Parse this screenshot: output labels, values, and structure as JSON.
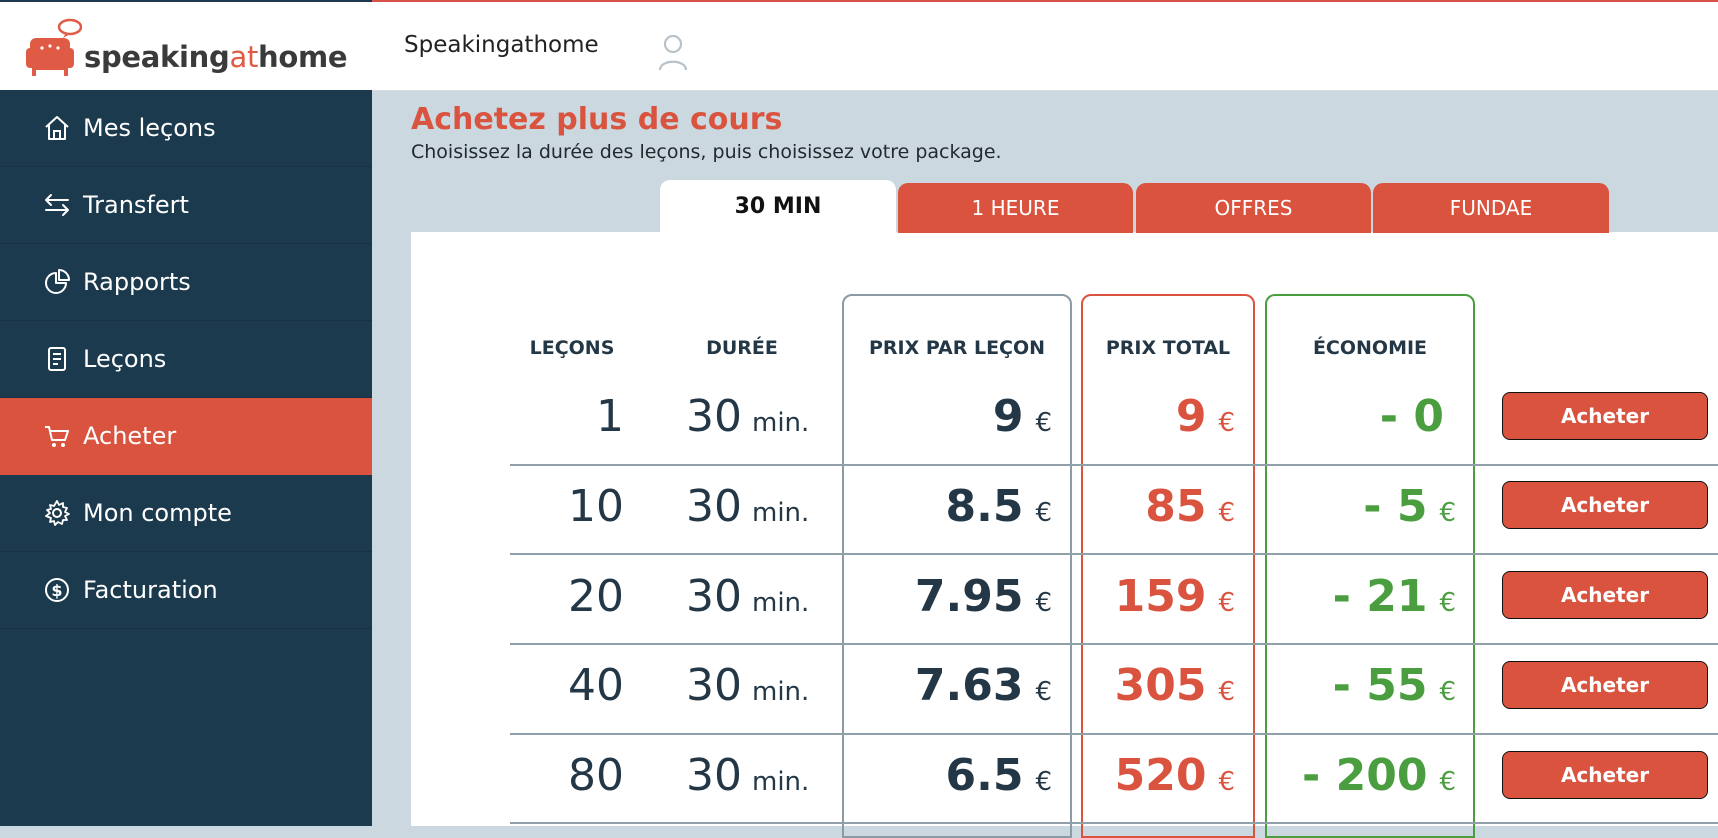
{
  "brand": {
    "logo_speaking": "speaking",
    "logo_at": "at",
    "logo_home": "home",
    "accent": "#d9533f",
    "sidebar_bg": "#1b3a4d",
    "save_green": "#4a9e3f"
  },
  "header": {
    "title": "Speakingathome"
  },
  "sidebar": {
    "items": [
      {
        "label": "Mes leçons",
        "icon": "home-icon"
      },
      {
        "label": "Transfert",
        "icon": "transfer-icon"
      },
      {
        "label": "Rapports",
        "icon": "pie-chart-icon"
      },
      {
        "label": "Leçons",
        "icon": "document-icon"
      },
      {
        "label": "Acheter",
        "icon": "cart-icon",
        "active": true
      },
      {
        "label": "Mon compte",
        "icon": "gear-icon"
      },
      {
        "label": "Facturation",
        "icon": "dollar-icon"
      }
    ]
  },
  "page": {
    "title": "Achetez plus de cours",
    "subtitle": "Choisissez la durée des leçons, puis choisissez votre package."
  },
  "tabs": [
    {
      "label": "30 MIN",
      "active": true
    },
    {
      "label": "1 HEURE"
    },
    {
      "label": "OFFRES"
    },
    {
      "label": "FUNDAE"
    }
  ],
  "table": {
    "headers": {
      "lessons": "LEÇONS",
      "duration": "DURÉE",
      "price_per": "PRIX PAR LEÇON",
      "total": "PRIX TOTAL",
      "savings": "ÉCONOMIE"
    },
    "currency": "€",
    "duration_unit": "min.",
    "buy_label": "Acheter",
    "rows": [
      {
        "lessons": "1",
        "duration": "30",
        "price": "9",
        "total": "9",
        "savings": "- 0",
        "savings_currency": ""
      },
      {
        "lessons": "10",
        "duration": "30",
        "price": "8.5",
        "total": "85",
        "savings": "- 5",
        "savings_currency": "€"
      },
      {
        "lessons": "20",
        "duration": "30",
        "price": "7.95",
        "total": "159",
        "savings": "- 21",
        "savings_currency": "€"
      },
      {
        "lessons": "40",
        "duration": "30",
        "price": "7.63",
        "total": "305",
        "savings": "- 55",
        "savings_currency": "€"
      },
      {
        "lessons": "80",
        "duration": "30",
        "price": "6.5",
        "total": "520",
        "savings": "- 200",
        "savings_currency": "€"
      }
    ]
  }
}
